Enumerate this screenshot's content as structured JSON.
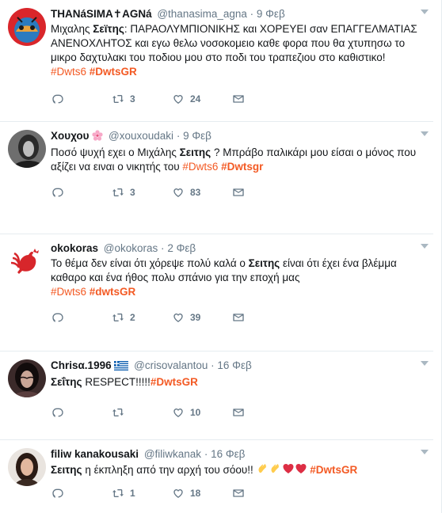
{
  "tweets": [
    {
      "name": "THANáSIMA✝AGNá",
      "handle": "@thanasima_agna",
      "time": "9 Φεβ",
      "text_pre": "Μιχαλης ",
      "text_bold": "Σεϊτης",
      "text_post": ": ΠΑΡΑΟΛΥΜΠΙΟΝΙΚΗΣ και ΧΟΡΕΥΕΙ σαν ΕΠΑΓΓΕΛΜΑΤΙΑΣ ΑΝΕΝΟΧΛΗΤΟΣ και εγω θελω νοσοκομειο καθε φορα που θα χτυπησω το μικρο δαχτυλακι του ποδιου μου στο ποδι του τραπεζιου στο καθιστικο!",
      "tags": [
        "#Dwts6",
        "#DwtsGR"
      ],
      "retweets": "3",
      "likes": "24"
    },
    {
      "name": "Χουχου",
      "handle": "@xouxoudaki",
      "time": "9 Φεβ",
      "text_pre": "Ποσό ψυχή εχει ο Μιχάλης ",
      "text_bold": "Σειτης",
      "text_post": " ? Μπράβο παλικάρι μου είσαι ο μόνος που αξίζει να ειναι ο νικητής του ",
      "tags": [
        "#Dwts6",
        "#Dwtsgr"
      ],
      "retweets": "3",
      "likes": "83"
    },
    {
      "name": "okokoras",
      "handle": "@okokoras",
      "time": "2 Φεβ",
      "text_pre": "Το θέμα δεν είναι ότι χόρεψε πολύ καλά ο ",
      "text_bold": "Σειτης",
      "text_post": " είναι ότι έχει ένα  βλέμμα καθαρο και ένα ήθος πολυ σπάνιο για την  εποχή μας",
      "tags": [
        "#Dwts6",
        "#dwtsGR"
      ],
      "retweets": "2",
      "likes": "39"
    },
    {
      "name": "Chrisα.1996",
      "handle": "@crisovalantou",
      "time": "16 Φεβ",
      "text_pre": "",
      "text_bold": "Σεΐτης",
      "text_post": " RESPECT!!!!!",
      "tags": [
        "#DwtsGR"
      ],
      "retweets": "",
      "likes": "10"
    },
    {
      "name": "filiw kanakousaki",
      "handle": "@filiwkanak",
      "time": "16 Φεβ",
      "text_pre": "",
      "text_bold": "Σειτης",
      "text_post": " η έκπληξη από την αρχή του σόου!! ",
      "tags": [
        "#DwtsGR"
      ],
      "retweets": "1",
      "likes": "18"
    }
  ],
  "icons": {
    "reply": "reply-icon",
    "retweet": "retweet-icon",
    "like": "heart-icon",
    "message": "direct-message-icon",
    "caret": "chevron-down-icon",
    "flower": "cherry-blossom-emoji",
    "flag": "greek-flag-emoji",
    "clap": "clapping-hands-emoji",
    "heart": "red-heart-emoji"
  },
  "colors": {
    "accent": "#f35a24",
    "muted": "#657786",
    "text": "#14171a",
    "divider": "#e6ecf0"
  }
}
